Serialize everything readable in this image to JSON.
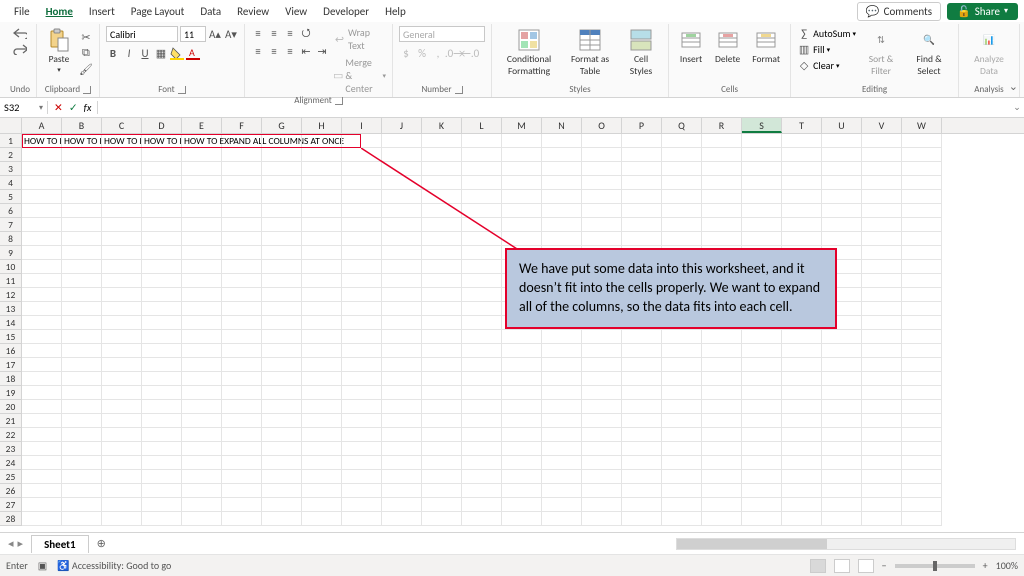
{
  "menubar": {
    "items": [
      "File",
      "Home",
      "Insert",
      "Page Layout",
      "Data",
      "Review",
      "View",
      "Developer",
      "Help"
    ],
    "active_index": 1,
    "comments_label": "Comments",
    "share_label": "Share"
  },
  "ribbon": {
    "undo": {
      "label": "Undo"
    },
    "clipboard": {
      "paste": "Paste",
      "label": "Clipboard"
    },
    "font": {
      "name": "Calibri",
      "size": "11",
      "bold": "B",
      "italic": "I",
      "underline": "U",
      "label": "Font"
    },
    "alignment": {
      "wrap": "Wrap Text",
      "merge": "Merge & Center",
      "label": "Alignment"
    },
    "number": {
      "format": "General",
      "label": "Number"
    },
    "styles": {
      "cond": "Conditional Formatting",
      "table": "Format as Table",
      "cell": "Cell Styles",
      "label": "Styles"
    },
    "cells": {
      "insert": "Insert",
      "delete": "Delete",
      "format": "Format",
      "label": "Cells"
    },
    "editing": {
      "autosum": "AutoSum",
      "fill": "Fill",
      "clear": "Clear",
      "sort": "Sort & Filter",
      "find": "Find & Select",
      "label": "Editing"
    },
    "analysis": {
      "analyze": "Analyze Data",
      "label": "Analysis"
    }
  },
  "fxbar": {
    "namebox": "S32",
    "cancel": "✕",
    "enter": "✓",
    "fx": "fx",
    "formula": ""
  },
  "grid": {
    "columns": [
      "A",
      "B",
      "C",
      "D",
      "E",
      "F",
      "G",
      "H",
      "I",
      "J",
      "K",
      "L",
      "M",
      "N",
      "O",
      "P",
      "Q",
      "R",
      "S",
      "T",
      "U",
      "V",
      "W"
    ],
    "selected_col_index": 18,
    "row_count": 28,
    "row1": {
      "A": "HOW TO E",
      "B": "HOW TO E",
      "C": "HOW TO E",
      "D": "HOW TO E",
      "E": "HOW TO EXPAND ALL COLUMNS AT ONCE"
    }
  },
  "annotation": {
    "text": "We have put some data into this worksheet, and it doesn’t fit into the cells properly. We want to expand all of the columns, so the data fits into each cell."
  },
  "sheetbar": {
    "tab": "Sheet1",
    "add": "+"
  },
  "status": {
    "mode": "Enter",
    "accessibility": "Accessibility: Good to go",
    "zoom_minus": "−",
    "zoom_plus": "+",
    "zoom": "100%"
  }
}
